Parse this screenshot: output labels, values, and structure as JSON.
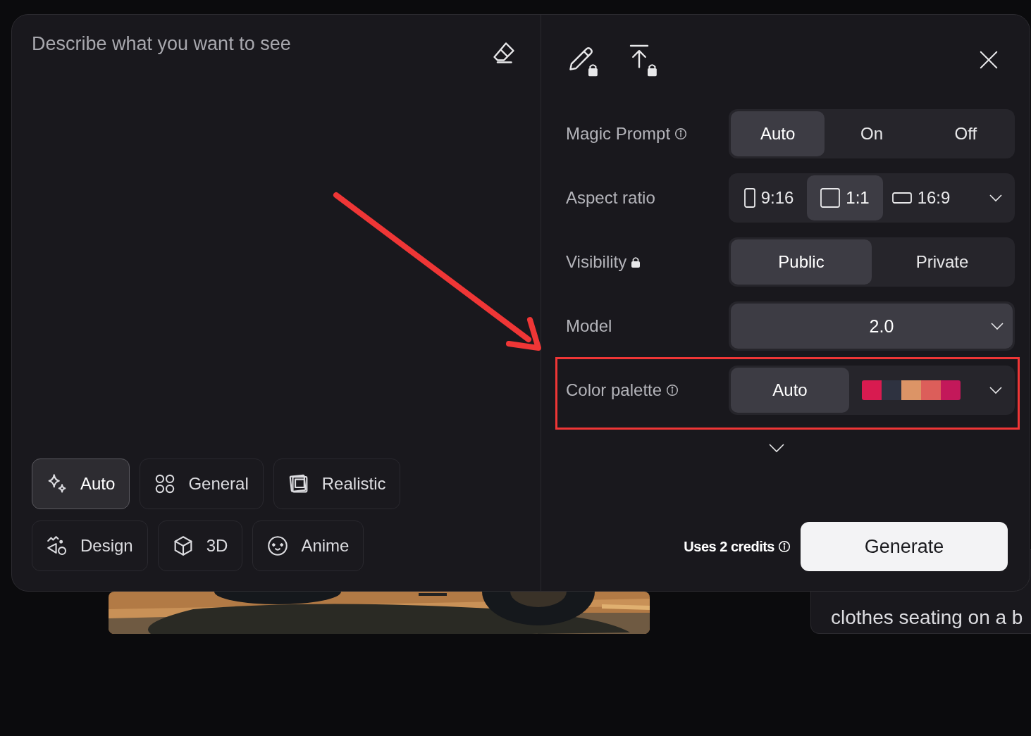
{
  "background": {
    "caption": "clothes seating on a b"
  },
  "prompt": {
    "placeholder": "Describe what you want to see"
  },
  "tools": [
    {
      "locked": true
    },
    {
      "locked": true
    }
  ],
  "settings": [
    {
      "kind": "segmented",
      "label": "Magic Prompt",
      "info": true,
      "options": [
        {
          "label": "Auto",
          "selected": true
        },
        {
          "label": "On",
          "selected": false
        },
        {
          "label": "Off",
          "selected": false
        }
      ]
    },
    {
      "kind": "aspect",
      "label": "Aspect ratio",
      "options": [
        {
          "label": "9:16",
          "selected": false
        },
        {
          "label": "1:1",
          "selected": true
        },
        {
          "label": "16:9",
          "selected": false
        }
      ]
    },
    {
      "kind": "segmented",
      "label": "Visibility",
      "locked": true,
      "options": [
        {
          "label": "Public",
          "selected": true
        },
        {
          "label": "Private",
          "selected": false
        }
      ]
    },
    {
      "kind": "select",
      "label": "Model",
      "value": "2.0"
    },
    {
      "kind": "palette",
      "label": "Color palette",
      "info": true,
      "options": [
        {
          "label": "Auto",
          "selected": true
        }
      ],
      "swatches": {
        "selected": false,
        "items": [
          {
            "color": "#d81b50"
          },
          {
            "color": "#2e3240"
          },
          {
            "color": "#dc9466"
          },
          {
            "color": "#dc5e5a"
          },
          {
            "color": "#c3185a"
          }
        ]
      }
    }
  ],
  "styles": [
    {
      "label": "Auto",
      "selected": true
    },
    {
      "label": "General",
      "selected": false
    },
    {
      "label": "Realistic",
      "selected": false
    },
    {
      "label": "Design",
      "selected": false
    },
    {
      "label": "3D",
      "selected": false
    },
    {
      "label": "Anime",
      "selected": false
    }
  ],
  "footer": {
    "credits": "Uses 2 credits",
    "button": "Generate"
  }
}
